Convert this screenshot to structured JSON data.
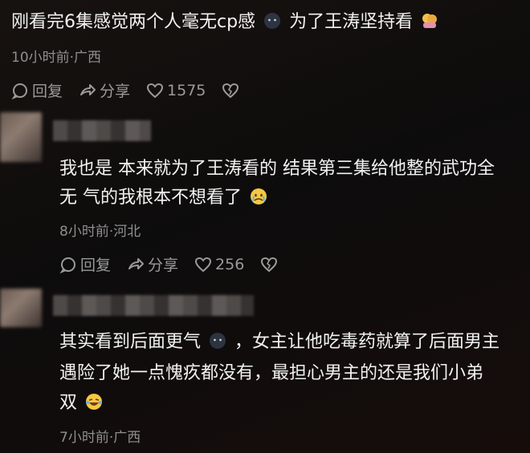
{
  "post": {
    "text_part1": "刚看完6集感觉两个人毫无cp感",
    "text_part2": "为了王涛坚持看",
    "meta": "10小时前·广西",
    "reply_label": "回复",
    "share_label": "分享",
    "like_count": "1575"
  },
  "comments": [
    {
      "line1": "我也是 本来就为了王涛看的 结果第三集给他整的武功全",
      "line2": "无 气的我根本不想看了",
      "meta": "8小时前·河北",
      "reply_label": "回复",
      "share_label": "分享",
      "like_count": "256"
    },
    {
      "line1_part1": "其实看到后面更气",
      "line1_part2": "，女主让他吃毒药就算了后面男主",
      "line2": "遇险了她一点愧疚都没有，最担心男主的还是我们小弟",
      "line3": "双",
      "meta": "7小时前·广西"
    }
  ],
  "colors": {
    "background": "#100d0c",
    "text": "#f2f2f2",
    "meta": "#8f8f8f"
  }
}
